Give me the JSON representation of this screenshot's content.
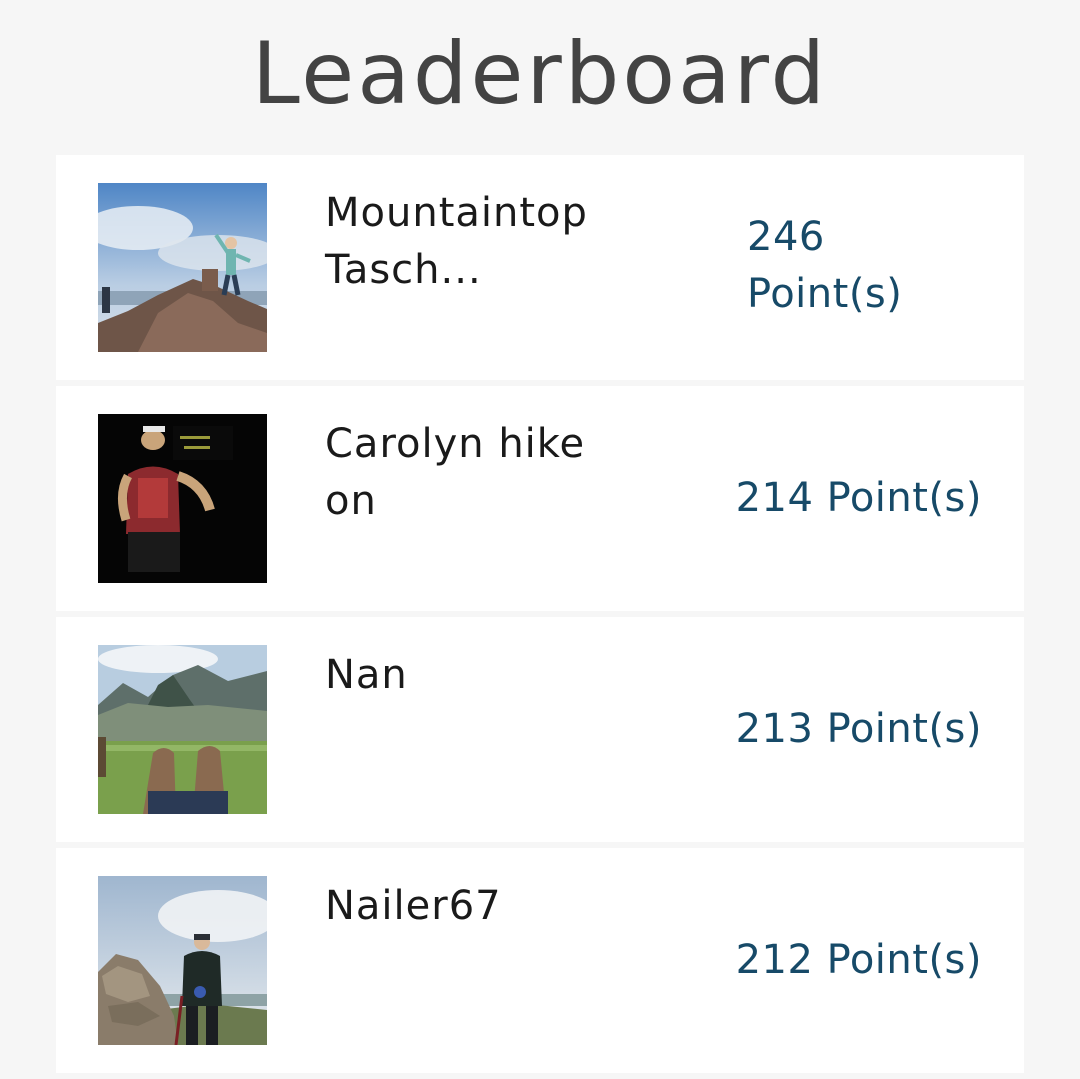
{
  "page": {
    "title": "Leaderboard"
  },
  "colors": {
    "background": "#f6f6f6",
    "card": "#ffffff",
    "title": "#434343",
    "name": "#1a1a1a",
    "points": "#174a68"
  },
  "leaderboard": [
    {
      "name": "Mountaintop Tasch...",
      "points": "246 Point(s)",
      "avatar_icon": "hiker-on-summit-photo"
    },
    {
      "name": "Carolyn hike on",
      "points": "214 Point(s)",
      "avatar_icon": "hiker-with-headlamp-photo"
    },
    {
      "name": "Nan",
      "points": "213 Point(s)",
      "avatar_icon": "machu-picchu-boots-photo"
    },
    {
      "name": "Nailer67",
      "points": "212 Point(s)",
      "avatar_icon": "hiker-by-cairn-photo"
    }
  ]
}
